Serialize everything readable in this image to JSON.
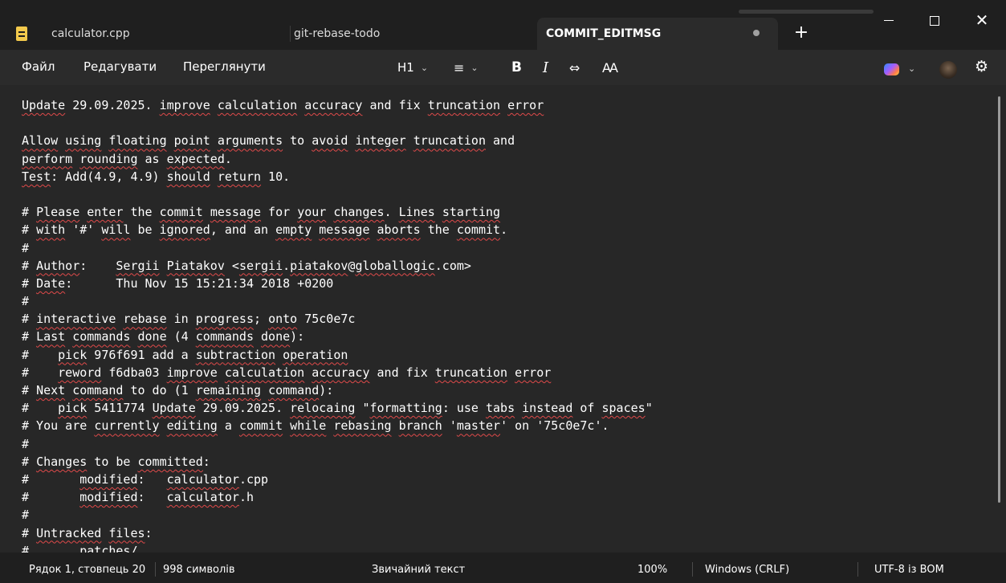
{
  "tabs": [
    {
      "label": "calculator.cpp"
    },
    {
      "label": "git-rebase-todo"
    },
    {
      "label": "COMMIT_EDITMSG"
    }
  ],
  "new_tab_glyph": "+",
  "window_controls": {
    "close_glyph": "✕"
  },
  "menu": {
    "file": "Файл",
    "edit": "Редагувати",
    "view": "Переглянути"
  },
  "toolbar": {
    "heading": "H1",
    "chevron": "⌄",
    "list_glyph": "≡",
    "bold": "B",
    "italic": "I",
    "link_glyph": "⇔",
    "spell_glyph": "Ꜳ",
    "settings_glyph": "⚙"
  },
  "editor_lines": [
    "Update 29.09.2025. improve calculation accuracy and fix truncation error",
    "",
    "Allow using floating point arguments to avoid integer truncation and",
    "perform rounding as expected.",
    "Test: Add(4.9, 4.9) should return 10.",
    "",
    "# Please enter the commit message for your changes. Lines starting",
    "# with '#' will be ignored, and an empty message aborts the commit.",
    "#",
    "# Author:    Sergii Piatakov <sergii.piatakov@globallogic.com>",
    "# Date:      Thu Nov 15 15:21:34 2018 +0200",
    "#",
    "# interactive rebase in progress; onto 75c0e7c",
    "# Last commands done (4 commands done):",
    "#    pick 976f691 add a subtraction operation",
    "#    reword f6dba03 improve calculation accuracy and fix truncation error",
    "# Next command to do (1 remaining command):",
    "#    pick 5411774 Update 29.09.2025. relocaing \"formatting: use tabs instead of spaces\"",
    "# You are currently editing a commit while rebasing branch 'master' on '75c0e7c'.",
    "#",
    "# Changes to be committed:",
    "#       modified:   calculator.cpp",
    "#       modified:   calculator.h",
    "#",
    "# Untracked files:",
    "#       patches/"
  ],
  "status": {
    "position": "Рядок 1, стовпець 20",
    "chars": "998 символів",
    "format": "Звичайний текст",
    "zoom": "100%",
    "line_ending": "Windows (CRLF)",
    "encoding": "UTF-8 із BOM"
  }
}
